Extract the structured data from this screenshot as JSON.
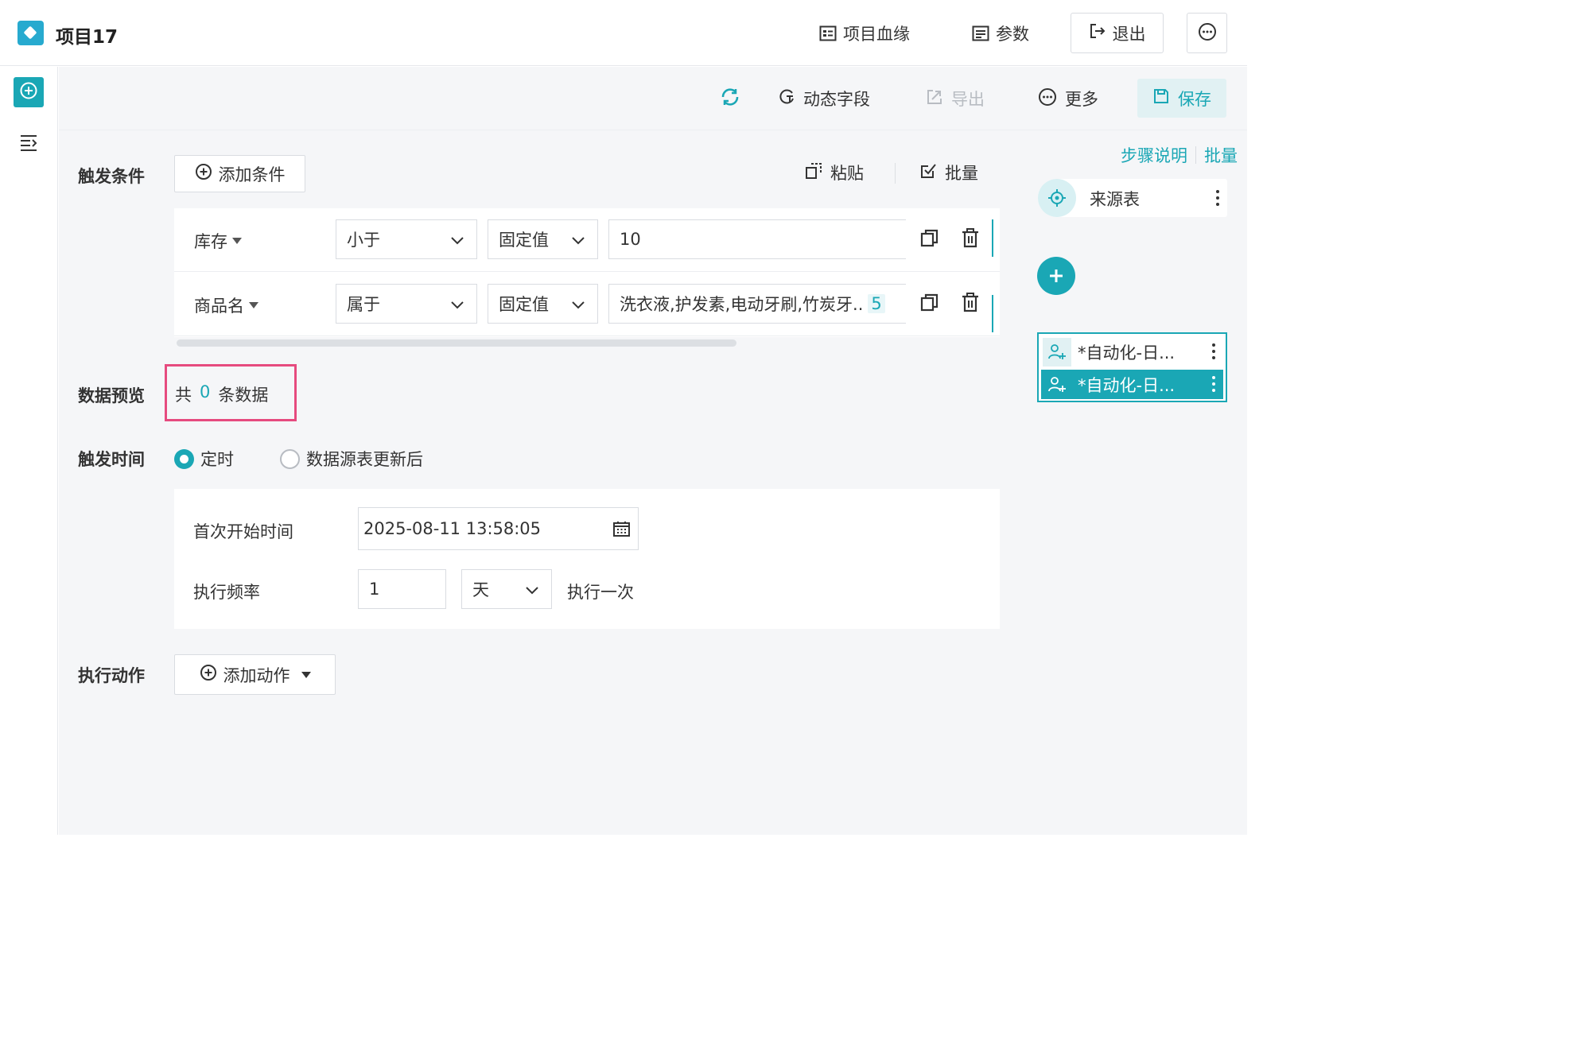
{
  "header": {
    "project_title": "项目17",
    "lineage_label": "项目血缘",
    "params_label": "参数",
    "exit_label": "退出"
  },
  "toolbar": {
    "dynamic_field_label": "动态字段",
    "export_label": "导出",
    "more_label": "更多",
    "save_label": "保存"
  },
  "trigger_condition": {
    "label": "触发条件",
    "add_condition_label": "添加条件",
    "paste_label": "粘贴",
    "batch_label": "批量",
    "rows": [
      {
        "field": "库存",
        "operator": "小于",
        "value_type": "固定值",
        "value": "10"
      },
      {
        "field": "商品名",
        "operator": "属于",
        "value_type": "固定值",
        "value": "洗衣液,护发素,电动牙刷,竹炭牙..",
        "count": "5"
      }
    ]
  },
  "data_preview": {
    "label": "数据预览",
    "prefix": "共",
    "count": "0",
    "suffix": "条数据"
  },
  "trigger_time": {
    "label": "触发时间",
    "options": [
      {
        "label": "定时",
        "checked": true
      },
      {
        "label": "数据源表更新后",
        "checked": false
      }
    ],
    "first_start_label": "首次开始时间",
    "first_start_value": "2025-08-11 13:58:05",
    "frequency_label": "执行频率",
    "frequency_value": "1",
    "frequency_unit": "天",
    "frequency_suffix": "执行一次"
  },
  "execute_action": {
    "label": "执行动作",
    "add_action_label": "添加动作"
  },
  "steps_panel": {
    "step_desc_label": "步骤说明",
    "batch_label": "批量",
    "source_label": "来源表",
    "actions": [
      {
        "label": "*自动化-日...",
        "active": false
      },
      {
        "label": "*自动化-日...",
        "active": true
      }
    ]
  },
  "colors": {
    "accent": "#1aa7b5",
    "highlight_border": "#e64b7f",
    "background": "#f5f6f8"
  }
}
